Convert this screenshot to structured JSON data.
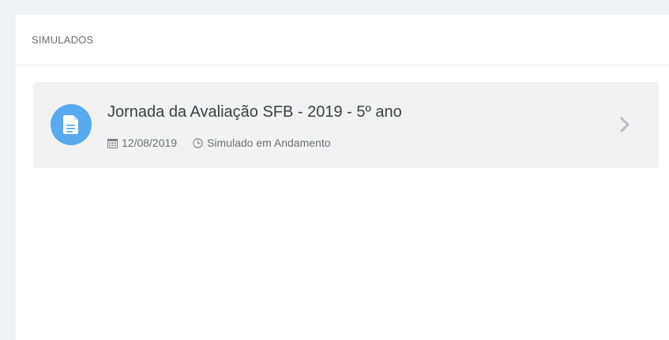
{
  "section": {
    "title": "SIMULADOS"
  },
  "simulados": [
    {
      "title": "Jornada da Avaliação SFB - 2019 - 5º ano",
      "date": "12/08/2019",
      "status": "Simulado em Andamento",
      "icons": {
        "main": "document-icon",
        "date": "calendar-icon",
        "status": "clock-icon",
        "action": "chevron-right-icon"
      }
    }
  ],
  "colors": {
    "page_background": "#f1f2f6",
    "card_background": "#f2f2f3",
    "icon_accent": "#58a9ee",
    "title_text": "#3b3f45",
    "meta_text": "#6c7077",
    "chevron": "#b9bcc2"
  }
}
